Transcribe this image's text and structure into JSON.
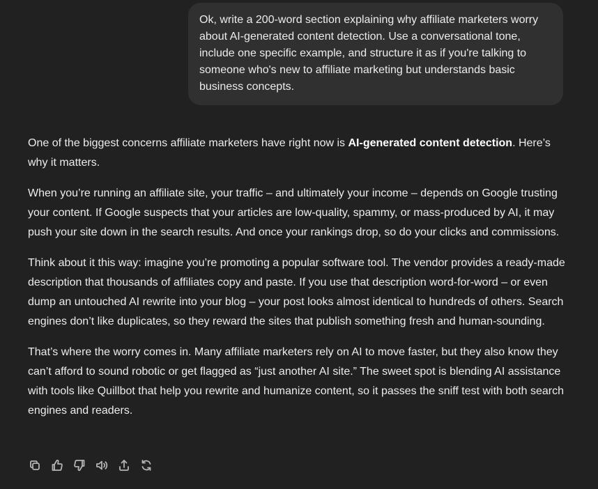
{
  "user_message": {
    "text": "Ok, write a 200-word section explaining why affiliate marketers worry about AI-generated content detection. Use a conversational tone, include one specific example, and structure it as if you're talking to someone who's new to affiliate marketing but understands basic business concepts."
  },
  "assistant_message": {
    "p1_before": "One of the biggest concerns affiliate marketers have right now is ",
    "p1_bold": "AI-generated content detection",
    "p1_after": ". Here’s why it matters.",
    "p2": "When you’re running an affiliate site, your traffic – and ultimately your income – depends on Google trusting your content. If Google suspects that your articles are low-quality, spammy, or mass-produced by AI, it may push your site down in the search results. And once your rankings drop, so do your clicks and commissions.",
    "p3": "Think about it this way: imagine you’re promoting a popular software tool. The vendor provides a ready-made description that thousands of affiliates copy and paste. If you use that description word-for-word – or even dump an untouched AI rewrite into your blog – your post looks almost identical to hundreds of others. Search engines don’t like duplicates, so they reward the sites that publish something fresh and human-sounding.",
    "p4": "That’s where the worry comes in. Many affiliate marketers rely on AI to move faster, but they also know they can’t afford to sound robotic or get flagged as “just another AI site.” The sweet spot is blending AI assistance with tools like Quillbot that help you rewrite and humanize content, so it passes the sniff test with both search engines and readers."
  },
  "actions": [
    {
      "icon": "copy-icon"
    },
    {
      "icon": "thumbs-up-icon"
    },
    {
      "icon": "thumbs-down-icon"
    },
    {
      "icon": "read-aloud-icon"
    },
    {
      "icon": "share-icon"
    },
    {
      "icon": "regenerate-icon"
    }
  ],
  "colors": {
    "background": "#212121",
    "user_bubble": "#303030",
    "text": "#ececec",
    "icon": "#b4b4b4"
  }
}
